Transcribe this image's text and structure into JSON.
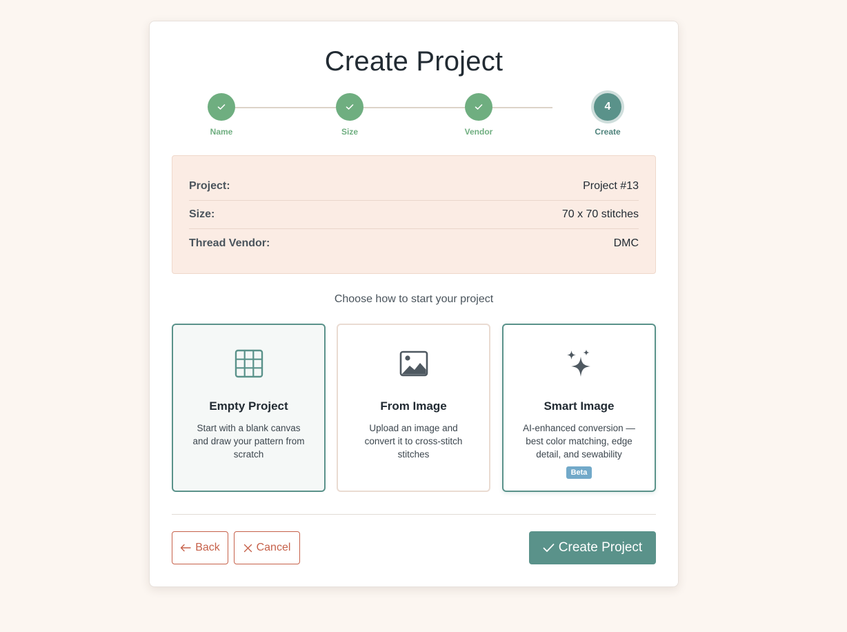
{
  "header": {
    "title": "Create Project"
  },
  "stepper": {
    "steps": [
      {
        "label": "Name",
        "state": "done"
      },
      {
        "label": "Size",
        "state": "done"
      },
      {
        "label": "Vendor",
        "state": "done"
      },
      {
        "label": "Create",
        "state": "active",
        "number": "4"
      }
    ]
  },
  "summary": {
    "rows": [
      {
        "key": "Project:",
        "value": "Project #13"
      },
      {
        "key": "Size:",
        "value": "70 x 70 stitches"
      },
      {
        "key": "Thread Vendor:",
        "value": "DMC"
      }
    ]
  },
  "chooser": {
    "prompt": "Choose how to start your project",
    "options": [
      {
        "name": "Empty Project",
        "description": "Start with a blank canvas and draw your pattern from scratch",
        "icon": "grid-icon"
      },
      {
        "name": "From Image",
        "description": "Upload an image and convert it to cross-stitch stitches",
        "icon": "image-icon"
      },
      {
        "name": "Smart Image",
        "description": "AI-enhanced conversion — best color matching, edge detail, and sewability",
        "icon": "sparkles-icon",
        "badge": "Beta"
      }
    ]
  },
  "actions": {
    "back_label": "Back",
    "cancel_label": "Cancel",
    "create_label": "Create Project"
  },
  "colors": {
    "accent": "#5a928a",
    "done": "#6fae80",
    "danger": "#c6614a",
    "summary_bg": "#fbece4",
    "badge": "#72a9c9"
  }
}
